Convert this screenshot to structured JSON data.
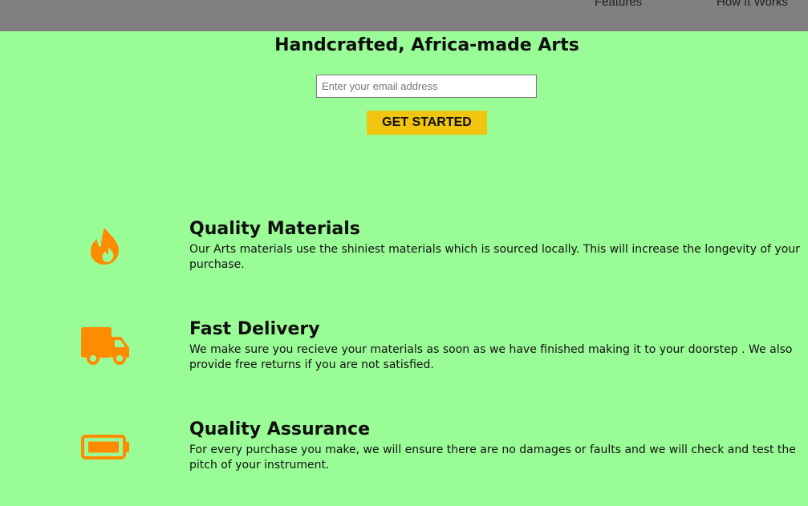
{
  "nav": {
    "features_label": "Features",
    "how_label": "How It Works"
  },
  "hero": {
    "title": "Handcrafted, Africa-made Arts",
    "email_placeholder": "Enter your email address",
    "cta_label": "GET STARTED"
  },
  "features": [
    {
      "icon": "fire-icon",
      "title": "Quality Materials",
      "description": "Our Arts materials use the shiniest materials which is sourced locally. This will increase the longevity of your purchase."
    },
    {
      "icon": "truck-icon",
      "title": "Fast Delivery",
      "description": "We make sure you recieve your materials as soon as we have finished making it to your doorstep . We also provide free returns if you are not satisfied."
    },
    {
      "icon": "battery-full-icon",
      "title": "Quality Assurance",
      "description": "For every purchase you make, we will ensure there are no damages or faults and we will check and test the pitch of your instrument."
    }
  ],
  "colors": {
    "page_background": "#9afc96",
    "navbar_background": "#7f7f7f",
    "icon_color": "#ff8c00",
    "cta_background": "#f1c40f"
  }
}
